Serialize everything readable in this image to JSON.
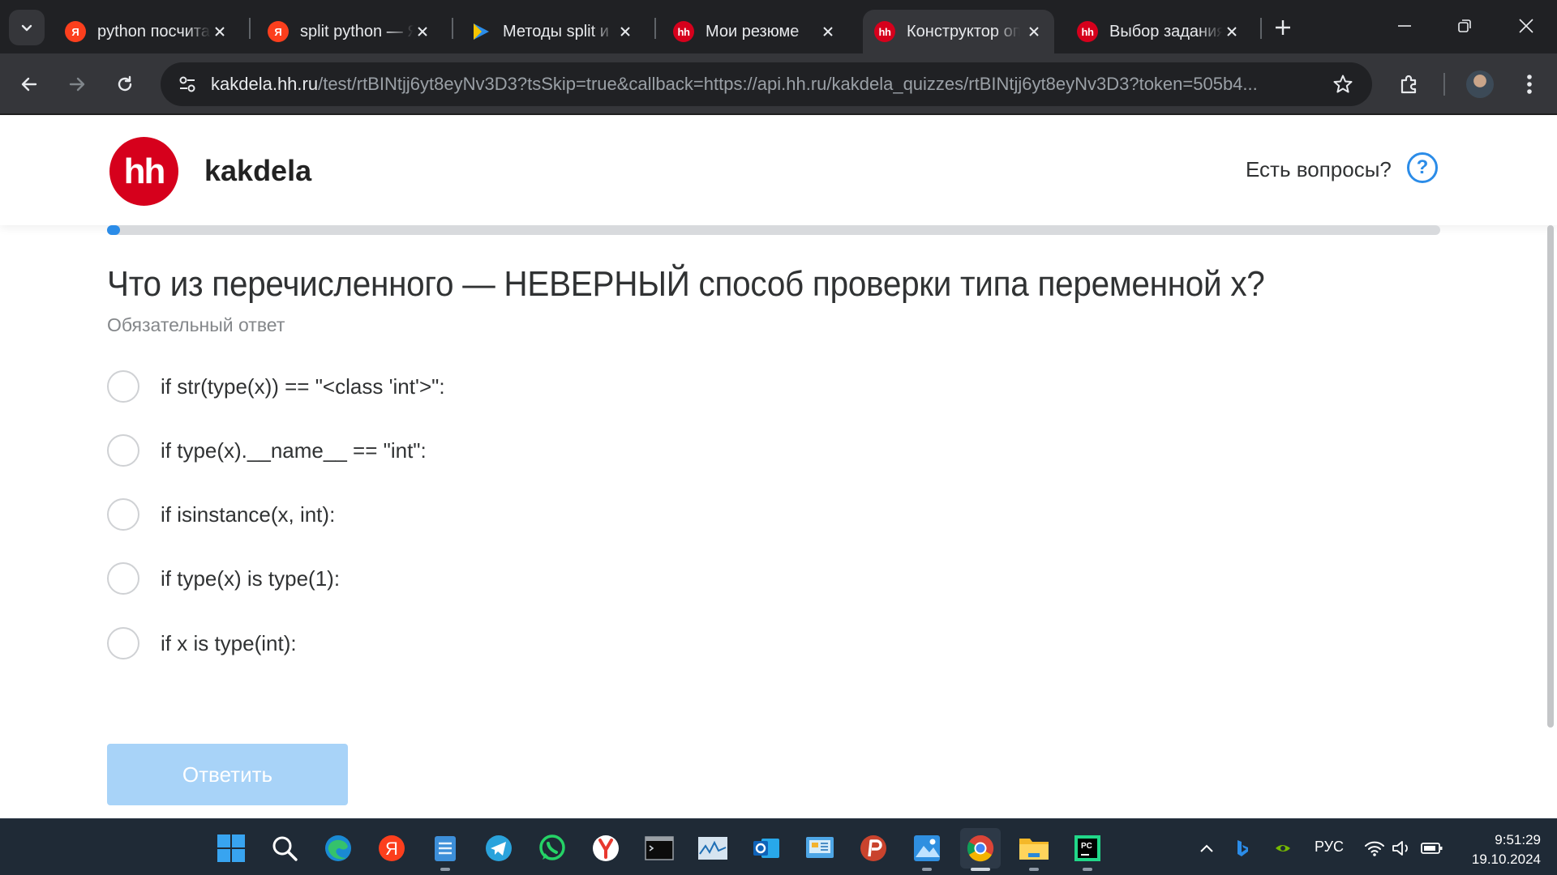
{
  "browser": {
    "tabs": [
      {
        "title": "python посчитать",
        "favicon": "yandex"
      },
      {
        "title": "split python — Яндекс",
        "favicon": "yandex"
      },
      {
        "title": "Методы split и",
        "favicon": "play"
      },
      {
        "title": "Мои резюме",
        "favicon": "hh"
      },
      {
        "title": "Конструктор опросов",
        "favicon": "hh"
      },
      {
        "title": "Выбор задания",
        "favicon": "hh"
      }
    ],
    "favicon_text": {
      "yandex": "Я",
      "hh": "hh"
    },
    "url_host": "kakdela.hh.ru",
    "url_rest": "/test/rtBINtjj6yt8eyNv3D3?tsSkip=true&callback=https://api.hh.ru/kakdela_quizzes/rtBINtjj6yt8eyNv3D3?token=505b4..."
  },
  "header": {
    "logo_text": "hh",
    "brand": "kakdela",
    "help_text": "Есть вопросы?",
    "help_icon_glyph": "?"
  },
  "progress": {
    "fraction": 0.01
  },
  "quiz": {
    "question": "Что из перечисленного — НЕВЕРНЫЙ способ проверки типа переменной x?",
    "required_note": "Обязательный ответ",
    "options": [
      "if str(type(x)) == \"<class 'int'>\":",
      "if type(x).__name__ == \"int\":",
      "if isinstance(x, int):",
      "if type(x) is type(1):",
      "if x is type(int):"
    ],
    "submit_label": "Ответить"
  },
  "taskbar": {
    "apps": [
      "windows-start-icon",
      "search-icon",
      "edge-icon",
      "yandex-icon",
      "notepad-icon",
      "telegram-icon",
      "whatsapp-icon",
      "yandex-browser-icon",
      "terminal-icon",
      "monitor-icon",
      "outlook-icon",
      "control-panel-icon",
      "p-app-icon",
      "photos-icon",
      "chrome-icon",
      "file-explorer-icon",
      "pycharm-icon"
    ],
    "pycharm_text": "PC",
    "language": "РУС",
    "time": "9:51:29",
    "date": "19.10.2024"
  },
  "colors": {
    "accent": "#2b8ce8",
    "hh_red": "#d6001c",
    "submit_disabled": "#a8d3f8"
  }
}
